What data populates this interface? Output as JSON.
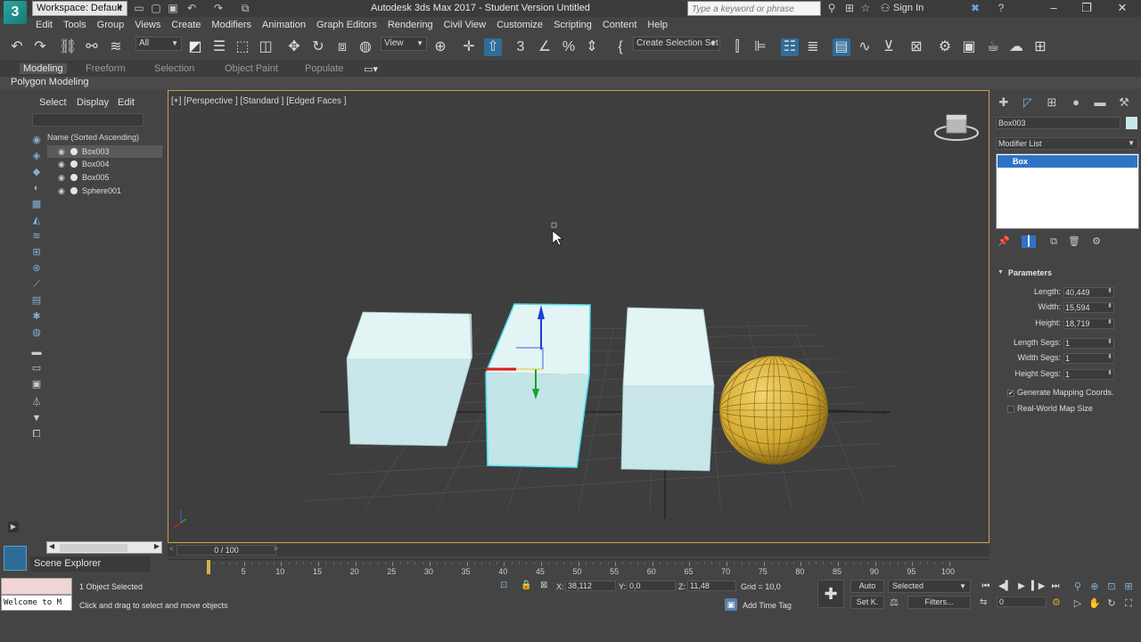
{
  "titlebar": {
    "workspace": "Workspace: Default",
    "app_title": "Autodesk 3ds Max 2017 - Student Version    Untitled",
    "search_placeholder": "Type a keyword or phrase",
    "sign_in": "Sign In",
    "logo": "3"
  },
  "menu": [
    "Edit",
    "Tools",
    "Group",
    "Views",
    "Create",
    "Modifiers",
    "Animation",
    "Graph Editors",
    "Rendering",
    "Civil View",
    "Customize",
    "Scripting",
    "Content",
    "Help"
  ],
  "toolbar": {
    "filter_value": "All",
    "view_value": "View",
    "selection_set": "Create Selection Set"
  },
  "ribbon": {
    "tabs": [
      "Modeling",
      "Freeform",
      "Selection",
      "Object Paint",
      "Populate"
    ],
    "active_tab": "Modeling",
    "subtitle": "Polygon Modeling"
  },
  "scene_explorer": {
    "tabs": [
      "Select",
      "Display",
      "Edit"
    ],
    "column_header": "Name (Sorted Ascending)",
    "items": [
      {
        "name": "Box003",
        "selected": true
      },
      {
        "name": "Box004",
        "selected": false
      },
      {
        "name": "Box005",
        "selected": false
      },
      {
        "name": "Sphere001",
        "selected": false
      }
    ],
    "panel_label": "Scene Explorer"
  },
  "viewport": {
    "label": "[+] [Perspective ] [Standard ] [Edged Faces ]",
    "colors": {
      "box": "#c7e9ec",
      "sphere": "#d9b13d",
      "border": "#c8a24a"
    }
  },
  "command_panel": {
    "object_name": "Box003",
    "object_color": "#c7e9ec",
    "modifier_list": "Modifier List",
    "stack_item": "Box",
    "rollout_title": "Parameters",
    "params": [
      {
        "label": "Length:",
        "value": "40,449"
      },
      {
        "label": "Width:",
        "value": "15,594"
      },
      {
        "label": "Height:",
        "value": "18,719"
      }
    ],
    "segs": [
      {
        "label": "Length Segs:",
        "value": "1"
      },
      {
        "label": "Width Segs:",
        "value": "1"
      },
      {
        "label": "Height Segs:",
        "value": "1"
      }
    ],
    "checks": [
      {
        "label": "Generate Mapping Coords.",
        "checked": true,
        "mark": "✔"
      },
      {
        "label": "Real-World Map Size",
        "checked": false,
        "mark": ""
      }
    ]
  },
  "timeline": {
    "frame_display": "0 / 100",
    "ticks": [
      "5",
      "10",
      "15",
      "20",
      "25",
      "30",
      "35",
      "40",
      "45",
      "50",
      "55",
      "60",
      "65",
      "70",
      "75",
      "80",
      "85",
      "90",
      "95",
      "100"
    ]
  },
  "status": {
    "maxscript_text": "Welcome to M",
    "selection_status": "1 Object Selected",
    "prompt": "Click and drag to select and move objects",
    "x_label": "X:",
    "x_value": "38,112",
    "y_label": "Y:",
    "y_value": "0,0",
    "z_label": "Z:",
    "z_value": "11,48",
    "grid": "Grid = 10,0",
    "add_time_tag": "Add Time Tag",
    "auto_key": "Auto",
    "set_key": "Set K.",
    "key_mode": "Selected",
    "filters": "Filters...",
    "frame_value": "0"
  }
}
